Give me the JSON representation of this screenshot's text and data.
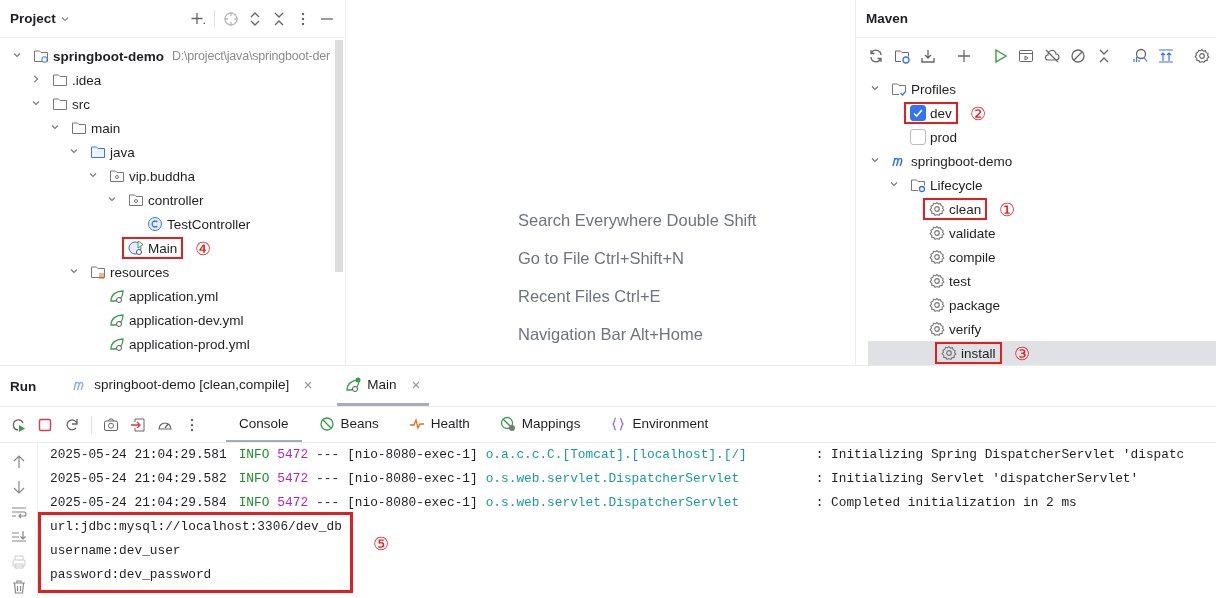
{
  "project": {
    "title": "Project",
    "tree": [
      {
        "label": "springboot-demo",
        "kind": "module",
        "path": "D:\\project\\java\\springboot-der",
        "expanded": true,
        "children": [
          {
            "label": ".idea",
            "kind": "folder",
            "expanded": false
          },
          {
            "label": "src",
            "kind": "folder",
            "expanded": true,
            "children": [
              {
                "label": "main",
                "kind": "folder",
                "expanded": true,
                "children": [
                  {
                    "label": "java",
                    "kind": "source-folder",
                    "expanded": true,
                    "children": [
                      {
                        "label": "vip.buddha",
                        "kind": "package",
                        "expanded": true,
                        "children": [
                          {
                            "label": "controller",
                            "kind": "package",
                            "expanded": true,
                            "children": [
                              {
                                "label": "TestController",
                                "kind": "class"
                              }
                            ]
                          },
                          {
                            "label": "Main",
                            "kind": "main-class",
                            "callout": "④"
                          }
                        ]
                      }
                    ]
                  },
                  {
                    "label": "resources",
                    "kind": "resources",
                    "expanded": true,
                    "children": [
                      {
                        "label": "application.yml",
                        "kind": "yaml"
                      },
                      {
                        "label": "application-dev.yml",
                        "kind": "yaml"
                      },
                      {
                        "label": "application-prod.yml",
                        "kind": "yaml"
                      }
                    ]
                  }
                ]
              }
            ]
          }
        ]
      }
    ]
  },
  "editor_hints": [
    "Search Everywhere Double Shift",
    "Go to File Ctrl+Shift+N",
    "Recent Files Ctrl+E",
    "Navigation Bar Alt+Home"
  ],
  "maven": {
    "title": "Maven",
    "tree": [
      {
        "label": "Profiles",
        "kind": "profiles",
        "expanded": true,
        "children": [
          {
            "label": "dev",
            "kind": "profile",
            "checked": true,
            "callout": "②"
          },
          {
            "label": "prod",
            "kind": "profile",
            "checked": false
          }
        ]
      },
      {
        "label": "springboot-demo",
        "kind": "maven",
        "expanded": true,
        "children": [
          {
            "label": "Lifecycle",
            "kind": "lifecycle",
            "expanded": true,
            "children": [
              {
                "label": "clean",
                "kind": "goal",
                "selected": false,
                "callout": "①"
              },
              {
                "label": "validate",
                "kind": "goal",
                "selected": false
              },
              {
                "label": "compile",
                "kind": "goal",
                "selected": false
              },
              {
                "label": "test",
                "kind": "goal",
                "selected": false
              },
              {
                "label": "package",
                "kind": "goal",
                "selected": false
              },
              {
                "label": "verify",
                "kind": "goal",
                "selected": false
              },
              {
                "label": "install",
                "kind": "goal",
                "selected": true,
                "callout": "③"
              }
            ]
          }
        ]
      }
    ]
  },
  "run": {
    "title": "Run",
    "tabs": [
      {
        "label": "springboot-demo [clean,compile]",
        "kind": "maven",
        "selected": false
      },
      {
        "label": "Main",
        "kind": "spring",
        "selected": true
      }
    ],
    "subtabs": [
      {
        "label": "Console",
        "kind": "console",
        "selected": true
      },
      {
        "label": "Beans",
        "kind": "beans",
        "selected": false
      },
      {
        "label": "Health",
        "kind": "health",
        "selected": false
      },
      {
        "label": "Mappings",
        "kind": "mappings",
        "selected": false
      },
      {
        "label": "Environment",
        "kind": "environment",
        "selected": false
      }
    ],
    "console": [
      {
        "kind": "log",
        "time": "2025-05-24 21:04:29.581",
        "level": "INFO",
        "pid": "5472",
        "sep": "---",
        "thread": "[nio-8080-exec-1]",
        "logger": "o.a.c.c.C.[Tomcat].[localhost].[/]",
        "message": ": Initializing Spring DispatcherServlet 'dispatc"
      },
      {
        "kind": "log",
        "time": "2025-05-24 21:04:29.582",
        "level": "INFO",
        "pid": "5472",
        "sep": "---",
        "thread": "[nio-8080-exec-1]",
        "logger": "o.s.web.servlet.DispatcherServlet",
        "message": ": Initializing Servlet 'dispatcherServlet'"
      },
      {
        "kind": "log",
        "time": "2025-05-24 21:04:29.584",
        "level": "INFO",
        "pid": "5472",
        "sep": "---",
        "thread": "[nio-8080-exec-1]",
        "logger": "o.s.web.servlet.DispatcherServlet",
        "message": ": Completed initialization in 2 ms"
      }
    ],
    "output_block": {
      "callout": "⑤",
      "lines": [
        "url:jdbc:mysql://localhost:3306/dev_db",
        "username:dev_user",
        "password:dev_password"
      ]
    }
  }
}
